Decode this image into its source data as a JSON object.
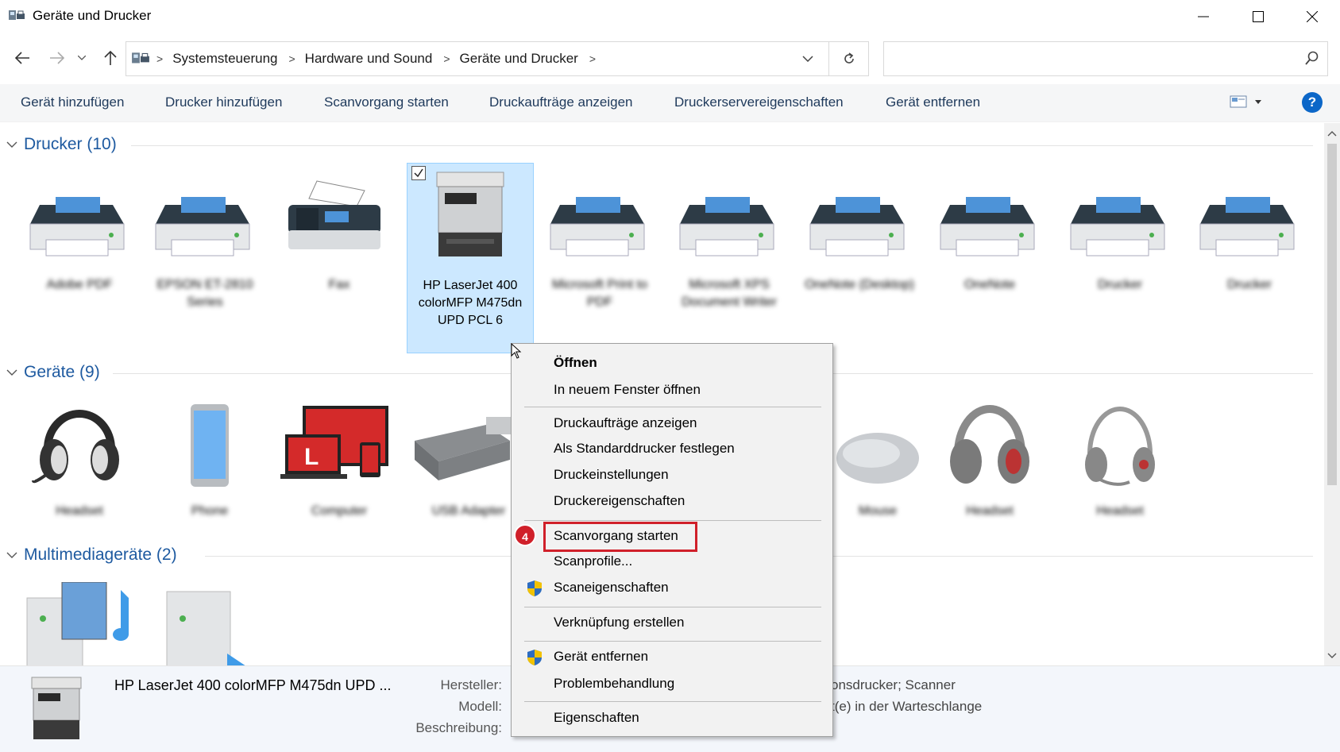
{
  "window": {
    "title": "Geräte und Drucker"
  },
  "address": {
    "breadcrumbs": [
      "Systemsteuerung",
      "Hardware und Sound",
      "Geräte und Drucker"
    ],
    "search_placeholder": ""
  },
  "toolbar": {
    "items": [
      "Gerät hinzufügen",
      "Drucker hinzufügen",
      "Scanvorgang starten",
      "Druckaufträge anzeigen",
      "Druckerservereigenschaften",
      "Gerät entfernen"
    ],
    "help": "?"
  },
  "groups": {
    "printers": {
      "label": "Drucker (10)"
    },
    "devices": {
      "label": "Geräte (9)"
    },
    "multimedia": {
      "label": "Multimediageräte (2)"
    }
  },
  "printers": [
    {
      "label": "Adobe PDF",
      "icon": "printer-icon"
    },
    {
      "label": "EPSON ET-2810 Series",
      "icon": "printer-icon"
    },
    {
      "label": "Fax",
      "icon": "fax-icon"
    },
    {
      "label": "HP LaserJet 400 colorMFP M475dn UPD PCL 6",
      "icon": "mfp-printer-icon",
      "selected": true
    },
    {
      "label": "Microsoft Print to PDF",
      "icon": "printer-icon"
    },
    {
      "label": "Microsoft XPS Document Writer",
      "icon": "printer-icon"
    },
    {
      "label": "OneNote (Desktop)",
      "icon": "printer-icon"
    },
    {
      "label": "OneNote",
      "icon": "printer-icon"
    },
    {
      "label": "Drucker",
      "icon": "printer-icon"
    },
    {
      "label": "Drucker",
      "icon": "printer-icon"
    }
  ],
  "devices": [
    {
      "label": "Headset",
      "icon": "headset-icon"
    },
    {
      "label": "Phone",
      "icon": "phone-icon"
    },
    {
      "label": "Computer",
      "icon": "computer-icon"
    },
    {
      "label": "USB Adapter",
      "icon": "usb-adapter-icon"
    },
    {
      "label": "Mouse",
      "icon": "mouse-icon"
    },
    {
      "label": "Headset",
      "icon": "headset-icon"
    },
    {
      "label": "Headset",
      "icon": "headset-icon"
    }
  ],
  "context_menu": {
    "items": [
      {
        "label": "Öffnen",
        "bold": true
      },
      {
        "label": "In neuem Fenster öffnen"
      },
      {
        "sep": true
      },
      {
        "label": "Druckaufträge anzeigen"
      },
      {
        "label": "Als Standarddrucker festlegen"
      },
      {
        "label": "Druckeinstellungen"
      },
      {
        "label": "Druckereigenschaften"
      },
      {
        "sep": true
      },
      {
        "label": "Scanvorgang starten",
        "highlighted": true
      },
      {
        "label": "Scanprofile..."
      },
      {
        "label": "Scaneigenschaften",
        "shield": true
      },
      {
        "sep": true
      },
      {
        "label": "Verknüpfung erstellen"
      },
      {
        "sep": true
      },
      {
        "label": "Gerät entfernen",
        "shield": true
      },
      {
        "label": "Problembehandlung"
      },
      {
        "sep": true
      },
      {
        "label": "Eigenschaften"
      }
    ],
    "step_badge": "4"
  },
  "details": {
    "name": "HP LaserJet 400 colorMFP M475dn UPD ...",
    "keys": {
      "manufacturer": "Hersteller:",
      "model": "Modell:",
      "description": "Beschreibung:"
    },
    "value_category": "onsdrucker; Scanner",
    "value_status": "t(e) in der Warteschlange"
  },
  "colors": {
    "accent": "#1e5aa0",
    "highlight": "#d0202a",
    "selection": "#cce8ff",
    "help": "#0c67c8"
  }
}
